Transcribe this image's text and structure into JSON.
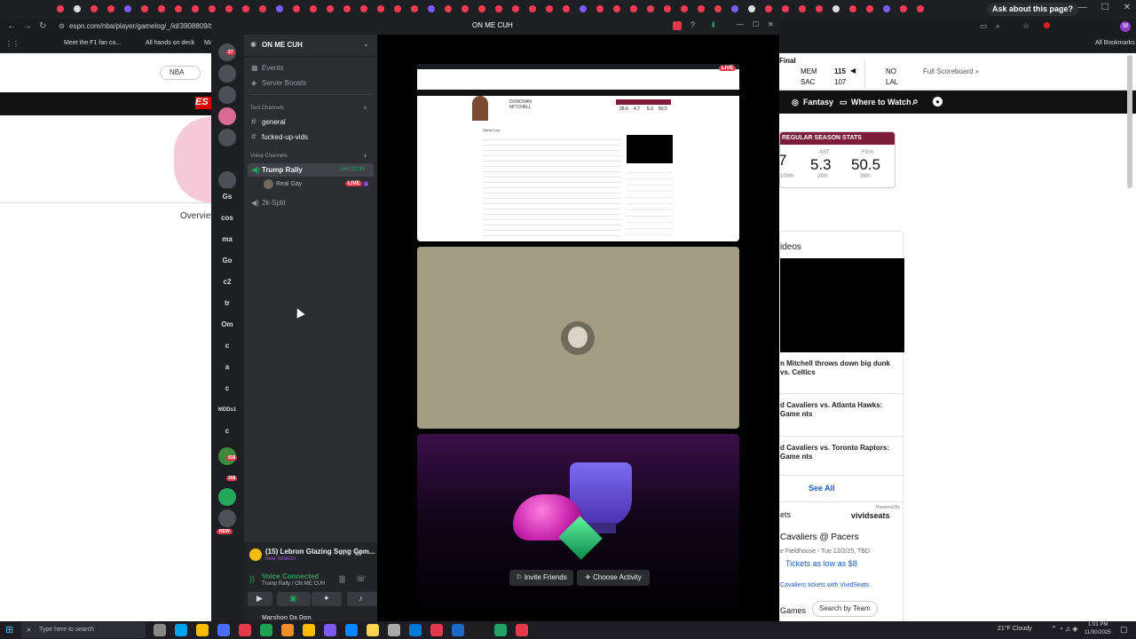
{
  "browser": {
    "url": "espn.com/nba/player/gamelog/_/id/3908809/type/",
    "ask_button": "Ask about this page?",
    "bookmarks": [
      "Meet the F1 fan co...",
      "All hands on deck",
      "Ma"
    ],
    "all_bookmarks": "All Bookmarks"
  },
  "espn": {
    "league_select": "NBA",
    "overview_tab": "Overview",
    "scoreboard": {
      "status": "Final",
      "rows": [
        {
          "team": "MEM",
          "score": "115",
          "opp_team": "NO"
        },
        {
          "team": "SAC",
          "score": "107",
          "opp_team": "LAL"
        }
      ],
      "full_link": "Full Scoreboard »"
    },
    "nav": {
      "fantasy": "Fantasy",
      "where_to_watch": "Where to Watch"
    },
    "season_stats": {
      "title": "REGULAR SEASON STATS",
      "stats": [
        {
          "label": "",
          "value": "7",
          "rank": "100th"
        },
        {
          "label": "AST",
          "value": "5.3",
          "rank": "28th"
        },
        {
          "label": "FG%",
          "value": "50.5",
          "rank": "38th"
        }
      ]
    },
    "videos": {
      "title": "ideos",
      "items": [
        "n Mitchell throws down big dunk vs. Celtics",
        "d Cavaliers vs. Atlanta Hawks: Game nts",
        "d Cavaliers vs. Toronto Raptors: Game nts"
      ],
      "see_all": "See All"
    },
    "tickets": {
      "title": "ets",
      "powered_by": "Powered By",
      "brand": "vividseats",
      "event": "Cavaliers @ Pacers",
      "venue": "e Fieldhouse - Tue 12/2/25, TBD",
      "price": "Tickets as low as $8",
      "link": "Cavaliers tickets with VividSeats",
      "games": "Games",
      "search_by": "Search by Team"
    }
  },
  "discord": {
    "window_title": "ON ME CUH",
    "server_name": "ON ME CUH",
    "menu": [
      "Events",
      "Server Boosts"
    ],
    "text_category": "Text Channels",
    "text_channels": [
      "general",
      "fucked-up-vids"
    ],
    "voice_category": "Voice Channels",
    "voice_channel": "Trump Rally",
    "voice_timer": "144:23:34",
    "voice_user": "Real Gay",
    "live_badge": "LIVE",
    "other_voice": "2k-Split",
    "server_labels": [
      "Gs",
      "cos",
      "ma",
      "Go",
      "c2",
      "tr",
      "Om",
      "c",
      "a",
      "c",
      "MDDs1",
      "c"
    ],
    "server_badges": [
      "27",
      "918",
      "208"
    ],
    "new_badge": "NEW",
    "activity": {
      "title": "(15) Lebron Glazing Song Com...",
      "sub": "Hello, WORLD!"
    },
    "voice_status": {
      "label": "Voice Connected",
      "channel": "Trump Rally / ON ME CUH"
    },
    "user_name": "Marshon Da Don",
    "stage_live": "LIVE",
    "invite_button": "Invite Friends",
    "activity_button": "Choose Activity"
  },
  "screen_share": {
    "player_name": "DONOVAN MITCHELL",
    "section": "Game Log",
    "stats": [
      "28.6",
      "4.7",
      "5.3",
      "50.5"
    ]
  },
  "taskbar": {
    "search_placeholder": "Type here to search",
    "weather": "21°F  Cloudy",
    "time": "1:01 PM",
    "date": "11/30/2025"
  },
  "colors": {
    "discord_bg": "#2b2d31",
    "discord_rail": "#1e1f22",
    "live_red": "#e4394c",
    "voice_green": "#23a55a",
    "tile_tan": "#a39b82",
    "espn_red": "#d00000",
    "stat_maroon": "#7b1d3a"
  }
}
